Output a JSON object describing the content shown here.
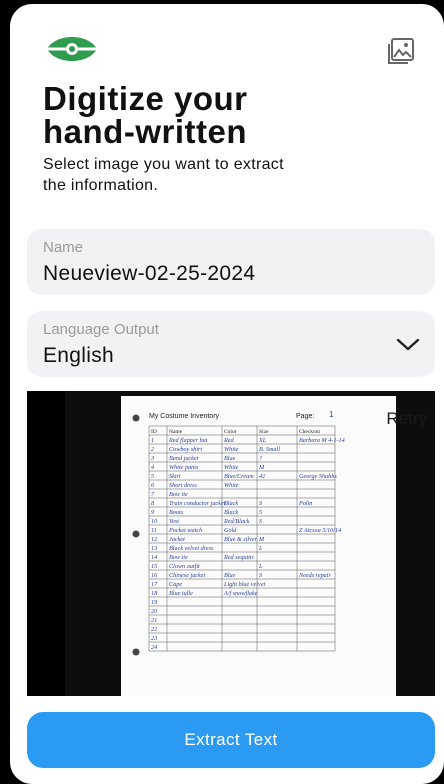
{
  "header": {
    "title_line1": "Digitize your",
    "title_line2": "hand-written",
    "subtitle": "Select image you want to extract the information."
  },
  "colors": {
    "accent": "#2b9af3",
    "logo": "#2e9b4e",
    "field_bg": "#f2f2f5"
  },
  "name_field": {
    "label": "Name",
    "value": "Neueview-02-25-2024"
  },
  "language_field": {
    "label": "Language Output",
    "value": "English"
  },
  "preview": {
    "retry_label": "Retry",
    "sheet_title": "My Costume Inventory",
    "sheet_page_label": "Page:",
    "sheet_page_value": "1",
    "columns": [
      "ID",
      "Name",
      "Color",
      "Size",
      "Checkout"
    ],
    "rows": [
      [
        "1",
        "Red flapper hat",
        "Red",
        "XL",
        "Barbara M 4-1-14"
      ],
      [
        "2",
        "Cowboy shirt",
        "White",
        "B. Small",
        ""
      ],
      [
        "3",
        "Band jacket",
        "Blue",
        "?",
        ""
      ],
      [
        "4",
        "White pants",
        "White",
        "M",
        ""
      ],
      [
        "5",
        "Skirt",
        "Blue/Cream",
        "42",
        "George Shabbs"
      ],
      [
        "6",
        "Short dress",
        "White",
        "",
        ""
      ],
      [
        "7",
        "Bow tie",
        "",
        "",
        ""
      ],
      [
        "8",
        "Train conductor jacket",
        "Black",
        "S",
        "Polin"
      ],
      [
        "9",
        "Boots",
        "Black",
        "5",
        ""
      ],
      [
        "10",
        "Vest",
        "Red/Black",
        "S",
        ""
      ],
      [
        "11",
        "Pocket watch",
        "Gold",
        "",
        "Z Aicsou 5/10/14"
      ],
      [
        "12",
        "Jacket",
        "Blue & silver",
        "M",
        ""
      ],
      [
        "13",
        "Black velvet dress",
        "",
        "L",
        ""
      ],
      [
        "14",
        "Bow tie",
        "Red sequins",
        "",
        ""
      ],
      [
        "15",
        "Clown outfit",
        "",
        "L",
        ""
      ],
      [
        "16",
        "Chinese jacket",
        "Blue",
        "S",
        "Needs repair"
      ],
      [
        "17",
        "Cape",
        "Light blue velvet",
        "",
        ""
      ],
      [
        "18",
        "Blue tulle",
        "A/f snowflake",
        "",
        ""
      ],
      [
        "19",
        "",
        "",
        "",
        ""
      ],
      [
        "20",
        "",
        "",
        "",
        ""
      ],
      [
        "21",
        "",
        "",
        "",
        ""
      ],
      [
        "22",
        "",
        "",
        "",
        ""
      ],
      [
        "23",
        "",
        "",
        "",
        ""
      ],
      [
        "24",
        "",
        "",
        "",
        ""
      ]
    ]
  },
  "actions": {
    "extract_label": "Extract Text"
  }
}
